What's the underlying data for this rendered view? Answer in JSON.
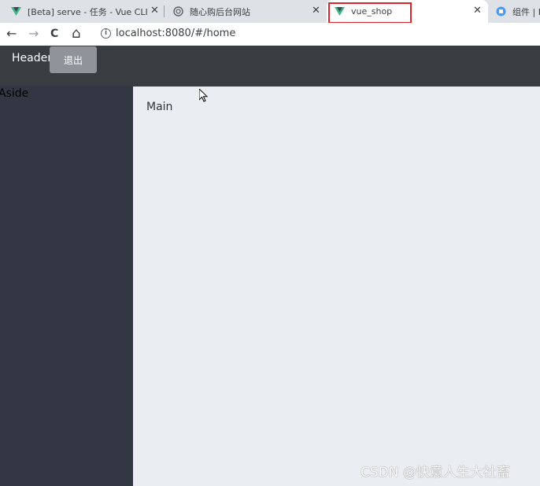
{
  "browser": {
    "tabs": [
      {
        "title": "[Beta] serve - 任务 - Vue CLI",
        "icon": "vue-logo-icon",
        "active": false
      },
      {
        "title": "随心购后台网站",
        "icon": "globe-icon",
        "active": false
      },
      {
        "title": "vue_shop",
        "icon": "vue-logo-icon",
        "active": true
      },
      {
        "title": "组件 | El",
        "icon": "element-logo-icon",
        "active": false
      }
    ],
    "close_glyph": "✕",
    "url": "localhost:8080/#/home",
    "nav": {
      "back": "←",
      "forward": "→",
      "reload": "C",
      "home": "⌂"
    },
    "info_glyph": "i",
    "highlight_color": "#e0212b"
  },
  "app": {
    "header": {
      "text": "Header",
      "logout_label": "退出",
      "bg": "#373d41"
    },
    "aside": {
      "text": "Aside",
      "bg": "#333744"
    },
    "main": {
      "text": "Main",
      "bg": "#eaedf1"
    }
  },
  "watermark": "CSDN @快意人生大社畜"
}
